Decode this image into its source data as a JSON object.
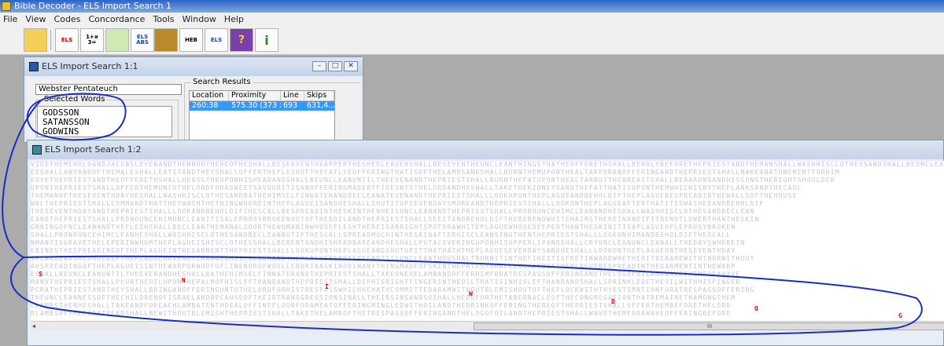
{
  "app": {
    "title": "Bible Decoder - ELS Import Search 1"
  },
  "menu": [
    "File",
    "View",
    "Codes",
    "Concordance",
    "Tools",
    "Window",
    "Help"
  ],
  "toolbar": {
    "buttons": [
      {
        "icon": "book-search-icon",
        "label": ""
      },
      {
        "icon": "els-hebrew-icon",
        "label": "ELS"
      },
      {
        "icon": "gematria-icon",
        "label": "1+א =3"
      },
      {
        "icon": "globe-arrow-icon",
        "label": ""
      },
      {
        "icon": "els-abs-icon",
        "label": "ELS ABS"
      },
      {
        "icon": "bible-book-icon",
        "label": ""
      },
      {
        "icon": "hebrew-keyboard-icon",
        "label": "HEB"
      },
      {
        "icon": "els-import-icon",
        "label": "ELS"
      },
      {
        "icon": "help-book-icon",
        "label": "?"
      },
      {
        "icon": "info-icon",
        "label": "i"
      }
    ]
  },
  "window1": {
    "title": "ELS Import Search 1:1",
    "file": "Webster Pentateuch",
    "selected_words_label": "Selected Words",
    "selected_words": [
      "GODSSON",
      "SATANSSON",
      "GODWINS"
    ],
    "results_label": "Search Results",
    "results_columns": [
      "Location",
      "Proximity",
      "Line",
      "Skips"
    ],
    "results_rows": [
      {
        "location": "260:38",
        "proximity": "575.30 (373 x ...",
        "line": "693",
        "skips": "631,4..."
      }
    ]
  },
  "window2": {
    "title": "ELS Import Search 1:2",
    "grid_rows": [
      "VIDETHEMEHOLDANDJACOBSLEVENANDTHENNOUTHEREOFHESHALLBESEAVENTHEAPPERTHESHEDLEAVENSHALLBESEVENTHEUNCLEANTHINGSTHATHEOFFERETHSHALLBEHOLYBEFORETHEPRIESTANDTHEMANSHALLWASHHISCLOTHESSANDSHALLBEUNCLEAN",
      "EESHALLANYANDOFTHEMALESHALLEATITANDTHEYSHALLOFFERTHEFLESHOFTHEFATLYEOFFERINGTHATISOFTHELAMBSANDSHALLBURNTHEMUPONTHEALTARFORANOFFERINGANDTHEPRIESTSHALLMAKEANATONEMENTFORHIM",
      "EOVETHEPRIESTANDTHEOFFERETHSHALLHEASSTHEUPONHISHEADANDSHALLBEUNCLEANUNTILTHEEVENANDTHEPRIESTSHALLBURNTHEFATUPONTHEALTARBUTTHEBREASTSHALLBEAARONSANDHISSONSTHERIGHTSHOULDER",
      "UPONTHEPRIESTSHALLOFFERTHEMUNTOTHELORDFORASWEETSAVOURITISANOFFERINGMADEBYFIREUNTOTHELORDANDHESHALLTAKETHEKIDNEYSANDTHEFATTHATISUPONTHEMWHICHISBYTHEFLANKSANDTHECAUL",
      "THEMANOFTHESEVENTHDAYHESHALLWASHHISCLOTHESANDBATHEHIMSELFINWATERANDBECLEANATEVENANDTHEPRIESTSHALLLOOKUPONTHEPLAGUEANDBEHOLDIFTHEPLAGUEBESPREADINTHEWALLSOFTHEHOUSE",
      "WBLTHEPRIESTSHALLCOMMANDTHATTHEYWASHTHETHINGWHEREINTHEPLAGUEISANDHESHALLSHUTITUPSEVENDAYSMOREANDTHEPRIESTSHALLLOOKONTHEPLAGUEAFTERTHATITISWASHEDANDBEHOLDIF",
      "THESEVENTHDAYANDTHEPRIESTSHALLLOOKANDBEHOLDIFTHESCALLBESPREADINTHESKINTHENHEISUNCLEANANDTHEPRIESTSHALLPRONOUNCEHIMCLEANANDHESHALLWASHHISCLOTHESANDBECLEAN",
      "EANDTHEPRIESTSHALLPRONOUNCEHIMUNCLEANITISALEPROSYBROKENOUTOFTHEBOILANDTHEPRIESTSHALLSEEITANDBEHOLDIFTHEREBENOWHITEHAIRSTHEREINANDIFITBENOTLOWERTHANTHESKIN",
      "GBNINGOFNCLEANANDTHEFLESHSHALLBECLEANTHEMANALSOORTHEWOMANINWHOSEFLESHTHEREISABRIGHTSPOTORAWHITEPLAGUEWHOSEDEEPERTHANTHESKINITISAPLAGUEOFLEPROSYBROKEN",
      "SHALLPRONOUNCEHIMCLEANHESHALLWASHHISCLOTHESANDBECLEANBUTIFTHESCALLSPREADMUCHINTHESKINAFTERHISCLEANSINGTHENTHEPRIESTSHALLLOOKONHIMANDBEHOLDIFTHESCALL",
      "NMANYISGRAVETHELEPERINWHOMTHEPLAGUEISHISCLOTHESSHALLBERENTANDHISHEADBAREANDHESHALLPUTACOVERINGUPONHISUPPERLIPANDSHALLCRYUNCLEANUNCLEANALLTHEDAYSWHEREIN",
      "EBINDSTHESPREADINGOFTHEPLAGUEINTHEGARMENTTHEPRIESTSHALLLOOKUPONTHEPLAGUEANDSHUTUPITTHATHATHTHEPLAGUESEVENDAYSANDHESHALLLOOKONTHEPLAGUEONTHESEVENTHDAY",
      "SPLAGUEWASHEDHOLDIFTHEPLAGUEHAVENOTCHANGEDHISCOLOURANDTHEPLAGUEBENOTSPREADITISUNCLEANTHOUSHALTBURNITINTHEFIREITISFRETINWARDWHETHERITBEBAREWITHINORWITHOUT",
      "AHSPREADINGOFTHEPLAGUEISINTHEWARPORWOOFOFLINENOROFWOOLLENORINASKINORINANYTHINGMADEOFSKINTHEPRIESTSHALLLOOKANDIFTHEPLAGUEBESPREADINTHEGARMENTINTHEWARP",
      "ESHALLBEUNCLEANUNTILTHEEVENANDHESHALLBATHEHIMSELFINWATERANDTHEPRIESTSHALLTAKEONEHELAMBANDOFFERHIMFORATRESPASSOFFERINGANDTHELOGOFOILANDWAVETHEMFORAWAVE",
      "MANVTHEPRIESTSHALLPOURTHEOILUPONTHEPALMOFHISLEFTHANDANDTHEPRIESTSHALLDIPHISRIGHTFINGERINTHEOILTHATISINHISLEFTHANDANDSHALLSPRINKLEOFTHEOILWITHHISFINGER",
      "PCRATHEPRIESTANDTHEYSHALLBRINGANOFFERINGUNTOTHELORDFORHISTRESPASSWHICHHEHATHCOMMITTEDARAMWITHOUTBLEMISHOUTOFTHEFLOCKWITHTHYESTIMATIONFORATRESPASSOFFERING",
      "THEUNCLEANNESSOFTHECHILDRENOFISRAELANDBECAUSEOFTHEIRTRANSGRESSIONSINALLTHEIRSINSANDSOSHALLHEDOFORTHETABERNACLEOFTHECONGREGATIONTHATREMAINETHAMONGTHEM",
      "CLAMBSTHENHESHALLTAKEANDFOREACHLAMBATENTHDEALOFFINEFLOURFORAMEATOFFERINGMINGLEDWITHOILANDTHEDRINKOFFERINGTHEREOFTHEPRIESTSHALLOFFERTHEMBEFORETHELORD",
      "RLAMBSOFTHEFIRSTYEARSHALLBEWITHOUTBLEMISHTHEPRIESTSHALLTAKETHELAMBOFTHETRESPASSOFFERINGANDTHELOGOFOILANDTHEPRIESTSHALLWAVETHEMFORAWAVEOFFERINGBEFORE"
    ],
    "found_letters": [
      "S",
      "N",
      "I",
      "W",
      "D",
      "O",
      "G"
    ],
    "scroll_marker": "III"
  }
}
